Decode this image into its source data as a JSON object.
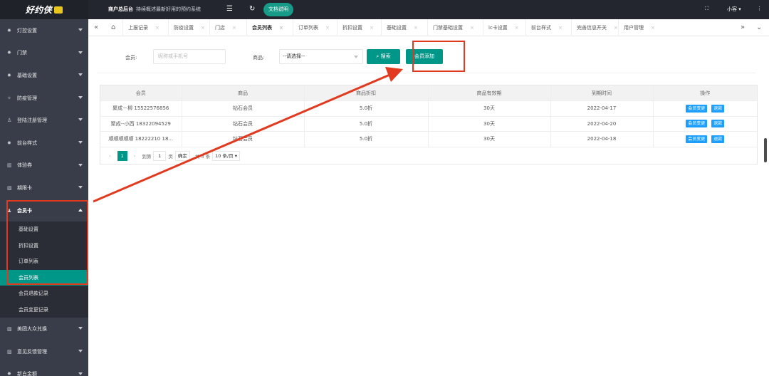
{
  "logo": "好约侠",
  "topbar": {
    "merchant_title": "商户总后台",
    "merchant_subtitle": "持续概述最新好用的预约系统",
    "doc_button": "文档说明",
    "user_name": "小客"
  },
  "sidebar": {
    "items": [
      {
        "label": "灯控设置",
        "icon": "✸"
      },
      {
        "label": "门禁",
        "icon": "✸"
      },
      {
        "label": "基础设置",
        "icon": "✸"
      },
      {
        "label": "防疫管理",
        "icon": "✧"
      },
      {
        "label": "登陆注册管理",
        "icon": "♙"
      },
      {
        "label": "前台样式",
        "icon": "✸"
      },
      {
        "label": "体验券",
        "icon": "▥"
      },
      {
        "label": "期限卡",
        "icon": "▧"
      },
      {
        "label": "会员卡",
        "icon": "♟"
      }
    ],
    "submenu": [
      "基础设置",
      "折扣设置",
      "订单列表",
      "会员列表",
      "会员退款记录",
      "会员变更记录"
    ],
    "items_after": [
      {
        "label": "美团大众兑换",
        "icon": "▧"
      },
      {
        "label": "意见反馈管理",
        "icon": "▨"
      },
      {
        "label": "新白金额",
        "icon": "✸"
      }
    ]
  },
  "tabs": [
    "上报记录",
    "防疫设置",
    "门店",
    "会员列表",
    "订单列表",
    "折扣设置",
    "基础设置",
    "门禁基础设置",
    "ic卡设置",
    "前台样式",
    "完善信息开关",
    "用户管理"
  ],
  "search": {
    "member_label": "会员:",
    "member_placeholder": "昵称或手机号",
    "product_label": "商品:",
    "product_value": "--请选择--",
    "search_button": "搜索",
    "add_button": "会员添加"
  },
  "table": {
    "headers": [
      "会员",
      "商品",
      "商品折扣",
      "商品有效期",
      "到期时间",
      "操作"
    ],
    "rows": [
      {
        "member": "聚成－柳 15522576856",
        "product": "钻石会员",
        "discount": "5.0折",
        "validity": "30天",
        "expiry": "2022-04-17"
      },
      {
        "member": "聚成--小西 18322094529",
        "product": "钻石会员",
        "discount": "5.0折",
        "validity": "30天",
        "expiry": "2022-04-20"
      },
      {
        "member": "顺顺顺顺顺 18222210 18...",
        "product": "钻石会员",
        "discount": "5.0折",
        "validity": "30天",
        "expiry": "2022-04-18"
      }
    ],
    "op_change": "会员变更",
    "op_refund": "退款"
  },
  "pager": {
    "current": "1",
    "goto_label": "到第",
    "page_value": "1",
    "page_unit": "页",
    "confirm": "确定",
    "total": "共 3 条",
    "page_size": "10 条/页"
  },
  "colors": {
    "accent": "#009688",
    "highlight": "#e23a1f",
    "link_button": "#1e9fff",
    "sidebar_bg": "#393d49"
  }
}
